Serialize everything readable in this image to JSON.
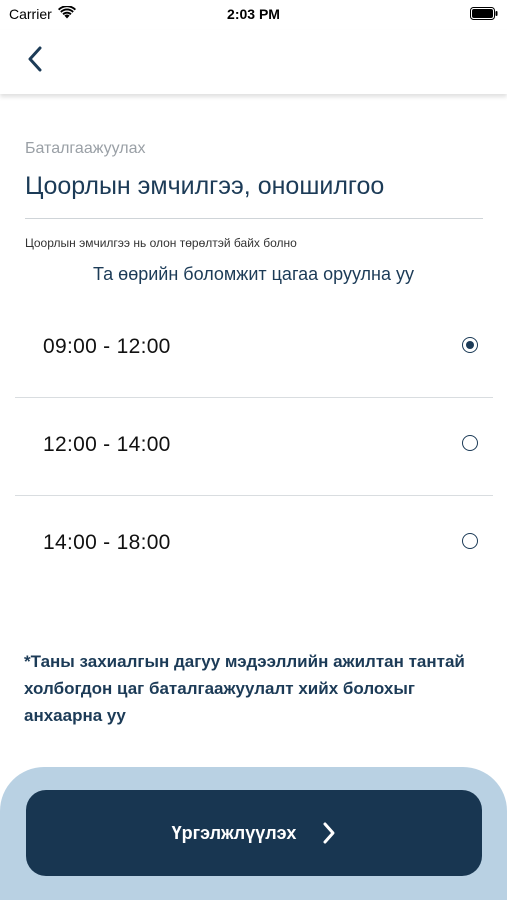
{
  "status_bar": {
    "carrier": "Carrier",
    "time": "2:03 PM"
  },
  "nav": {
    "back_icon": "chevron-left-icon"
  },
  "header": {
    "breadcrumb": "Баталгаажуулах",
    "title": "Цоорлын эмчилгээ, оношилгоо",
    "note": "Цоорлын эмчилгээ нь олон төрөлтэй байх болно"
  },
  "instruction": "Та өөрийн боломжит цагаа оруулна уу",
  "time_slots": [
    {
      "label": "09:00 - 12:00",
      "selected": true
    },
    {
      "label": "12:00 - 14:00",
      "selected": false
    },
    {
      "label": "14:00 - 18:00",
      "selected": false
    }
  ],
  "notice": "*Таны захиалгын дагуу мэдээллийн ажилтан тантай холбогдон цаг баталгаажуулалт хийх болохыг анхаарна уу",
  "footer": {
    "continue_label": "Үргэлжлүүлэх",
    "continue_icon": "chevron-right-icon"
  },
  "colors": {
    "primary": "#1c3b57",
    "button": "#183651",
    "panel": "#b9d1e3"
  }
}
